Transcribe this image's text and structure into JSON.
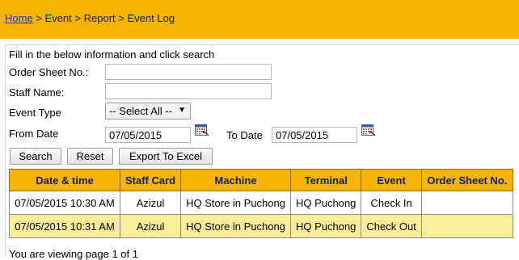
{
  "breadcrumb": {
    "home": "Home",
    "separator": ">",
    "event": "Event",
    "report": "Report",
    "current": "Event Log"
  },
  "form": {
    "instructions": "Fill in the below information and click search",
    "order_sheet_label": "Order Sheet No.:",
    "order_sheet_value": "",
    "staff_name_label": "Staff Name:",
    "staff_name_value": "",
    "event_type_label": "Event Type",
    "event_type_selected": "-- Select All --",
    "from_date_label": "From Date",
    "from_date_value": "07/05/2015",
    "to_date_label": "To Date",
    "to_date_value": "07/05/2015"
  },
  "buttons": {
    "search": "Search",
    "reset": "Reset",
    "export": "Export To Excel"
  },
  "table": {
    "headers": [
      "Date & time",
      "Staff Card",
      "Machine",
      "Terminal",
      "Event",
      "Order Sheet No."
    ],
    "rows": [
      [
        "07/05/2015 10:30 AM",
        "Azizul",
        "HQ Store in Puchong",
        "HQ Puchong",
        "Check In",
        ""
      ],
      [
        "07/05/2015 10:31 AM",
        "Azizul",
        "HQ Store in Puchong",
        "HQ Puchong",
        "Check Out",
        ""
      ]
    ]
  },
  "paging": {
    "text": "You are viewing page 1 of 1"
  },
  "colors": {
    "header_bar": "#f4b400",
    "alt_row": "#fbee9b",
    "link": "#1a3aa8"
  }
}
